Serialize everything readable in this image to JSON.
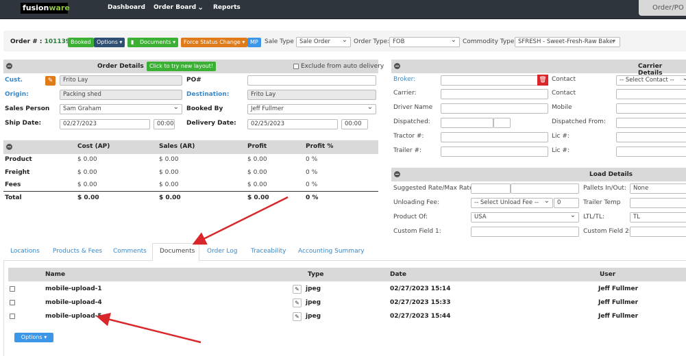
{
  "nav": {
    "logo_a": "fusion",
    "logo_b": "ware",
    "items": [
      "Dashboard",
      "Order Board",
      "Reports"
    ],
    "order_po_tab": "Order/PO"
  },
  "header": {
    "order_label": "Order # :",
    "order_number": "101139",
    "status": "Booked",
    "options": "Options ▾",
    "documents": "Documents ▾",
    "force_status": "Force Status Change ▾",
    "mp": "MP",
    "sale_type_label": "Sale Type",
    "sale_type": "Sale Order",
    "order_type_label": "Order Type:",
    "order_type": "FOB",
    "commodity_label": "Commodity Type:",
    "commodity": "SFRESH - Sweet-Fresh-Raw Baker"
  },
  "order_details": {
    "title": "Order Details",
    "new_layout": "Click to try new layout!",
    "exclude": "Exclude from auto delivery",
    "cust_label": "Cust.",
    "cust": "Frito Lay",
    "po_label": "PO#",
    "po": "",
    "origin_label": "Origin:",
    "origin": "Packing shed",
    "dest_label": "Destination:",
    "dest": "Frito Lay",
    "sales_label": "Sales Person",
    "sales": "Sam Graham",
    "booked_label": "Booked By",
    "booked": "Jeff Fullmer",
    "ship_label": "Ship Date:",
    "ship_date": "02/27/2023",
    "ship_time": "00:00",
    "delivery_label": "Delivery Date:",
    "delivery_date": "02/25/2023",
    "delivery_time": "00:00"
  },
  "financials": {
    "headers": [
      "Cost (AP)",
      "Sales (AR)",
      "Profit",
      "Profit %"
    ],
    "rows": [
      {
        "label": "Product",
        "values": [
          "$  0.00",
          "$  0.00",
          "$  0.00",
          "0 %"
        ]
      },
      {
        "label": "Freight",
        "values": [
          "$  0.00",
          "$  0.00",
          "$  0.00",
          "0 %"
        ]
      },
      {
        "label": "Fees",
        "values": [
          "$  0.00",
          "$  0.00",
          "$  0.00",
          "0 %"
        ]
      },
      {
        "label": "Total",
        "values": [
          "$  0.00",
          "$  0.00",
          "$  0.00",
          "0 %"
        ]
      }
    ]
  },
  "carrier": {
    "title": "Carrier Details",
    "left": [
      "Broker:",
      "Carrier:",
      "Driver Name",
      "Dispatched:",
      "Tractor #:",
      "Trailer #:"
    ],
    "right": [
      "Contact",
      "Contact",
      "Mobile",
      "Dispatched From:",
      "Lic #:",
      "Lic #:"
    ],
    "contact_select": "-- Select Contact --"
  },
  "load": {
    "title": "Load Details",
    "left": [
      "Suggested Rate/Max Rate:",
      "Unloading Fee:",
      "Product Of:",
      "Custom Field 1:"
    ],
    "right": [
      "Pallets In/Out:",
      "Trailer Temp",
      "LTL/TL:",
      "Custom Field 2:"
    ],
    "unload_fee": "-- Select Unload Fee --",
    "unload_amount": "0",
    "product_of": "USA",
    "pallets": "None",
    "ltl": "TL"
  },
  "tabs": [
    "Locations",
    "Products & Fees",
    "Comments",
    "Documents",
    "Order Log",
    "Traceability",
    "Accounting Summary"
  ],
  "documents": {
    "headers": [
      "Name",
      "Type",
      "Date",
      "User"
    ],
    "rows": [
      {
        "name": "mobile-upload-1",
        "type": "jpeg",
        "date": "02/27/2023 15:14",
        "user": "Jeff Fullmer"
      },
      {
        "name": "mobile-upload-4",
        "type": "jpeg",
        "date": "02/27/2023 15:33",
        "user": "Jeff Fullmer"
      },
      {
        "name": "mobile-upload-5",
        "type": "jpeg",
        "date": "02/27/2023 15:44",
        "user": "Jeff Fullmer"
      }
    ],
    "options": "Options ▾"
  },
  "colors": {
    "green": "#3cb034",
    "navy": "#2f4e74",
    "orange": "#e07b1a",
    "blue": "#3c97e8",
    "red": "#d9262a"
  }
}
